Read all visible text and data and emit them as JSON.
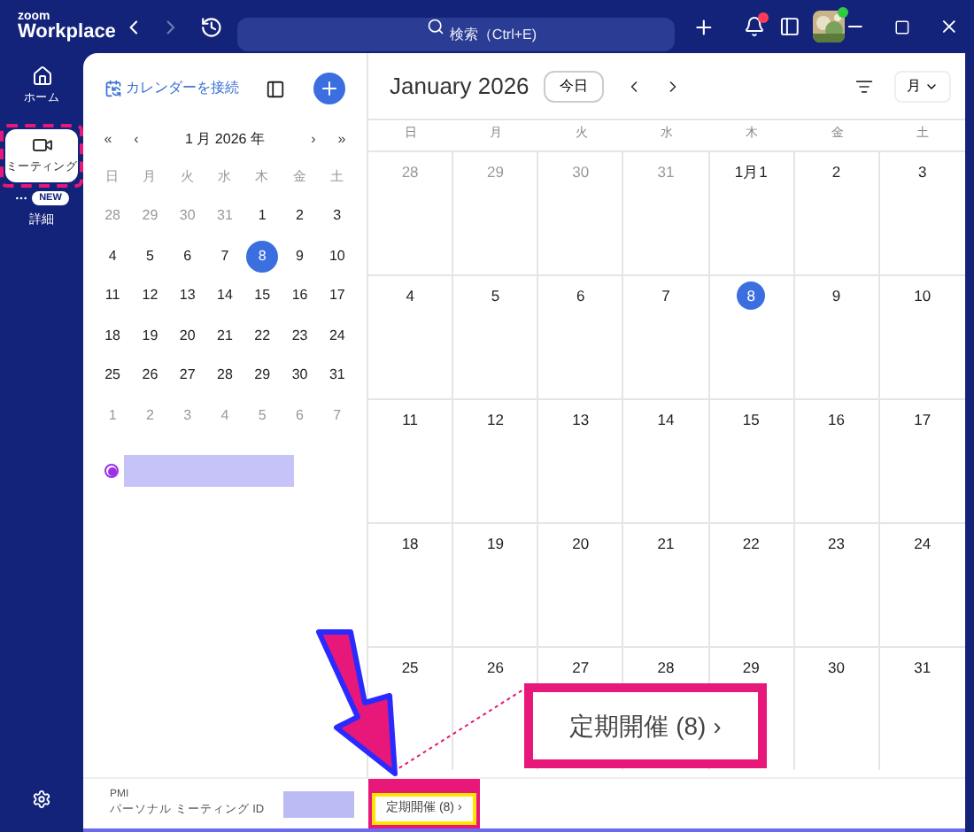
{
  "topbar": {
    "logo_small": "zoom",
    "logo": "Workplace",
    "search": {
      "placeholder": "検索（Ctrl+E)"
    },
    "notification": true
  },
  "rail": {
    "items": [
      {
        "label": "ホーム",
        "selected": false
      },
      {
        "label": "ミーティング",
        "selected": true
      }
    ],
    "more": {
      "badge": "NEW",
      "label": "詳細"
    }
  },
  "mini_calendar": {
    "connect": "カレンダーを接続",
    "nav": [
      "«",
      "‹",
      "›",
      "»"
    ],
    "month": "1 月 2026 年",
    "weekdays": [
      "日",
      "月",
      "火",
      "水",
      "木",
      "金",
      "土"
    ],
    "weeks": [
      [
        {
          "d": "28",
          "muted": true,
          "selected": false
        },
        {
          "d": "29",
          "muted": true,
          "selected": false
        },
        {
          "d": "30",
          "muted": true,
          "selected": false
        },
        {
          "d": "31",
          "muted": true,
          "selected": false
        },
        {
          "d": "1",
          "muted": false,
          "selected": false
        },
        {
          "d": "2",
          "muted": false,
          "selected": false
        },
        {
          "d": "3",
          "muted": false,
          "selected": false
        }
      ],
      [
        {
          "d": "4",
          "muted": false,
          "selected": false
        },
        {
          "d": "5",
          "muted": false,
          "selected": false
        },
        {
          "d": "6",
          "muted": false,
          "selected": false
        },
        {
          "d": "7",
          "muted": false,
          "selected": false
        },
        {
          "d": "8",
          "muted": false,
          "selected": true
        },
        {
          "d": "9",
          "muted": false,
          "selected": false
        },
        {
          "d": "10",
          "muted": false,
          "selected": false
        }
      ],
      [
        {
          "d": "11",
          "muted": false,
          "selected": false
        },
        {
          "d": "12",
          "muted": false,
          "selected": false
        },
        {
          "d": "13",
          "muted": false,
          "selected": false
        },
        {
          "d": "14",
          "muted": false,
          "selected": false
        },
        {
          "d": "15",
          "muted": false,
          "selected": false
        },
        {
          "d": "16",
          "muted": false,
          "selected": false
        },
        {
          "d": "17",
          "muted": false,
          "selected": false
        }
      ],
      [
        {
          "d": "18",
          "muted": false,
          "selected": false
        },
        {
          "d": "19",
          "muted": false,
          "selected": false
        },
        {
          "d": "20",
          "muted": false,
          "selected": false
        },
        {
          "d": "21",
          "muted": false,
          "selected": false
        },
        {
          "d": "22",
          "muted": false,
          "selected": false
        },
        {
          "d": "23",
          "muted": false,
          "selected": false
        },
        {
          "d": "24",
          "muted": false,
          "selected": false
        }
      ],
      [
        {
          "d": "25",
          "muted": false,
          "selected": false
        },
        {
          "d": "26",
          "muted": false,
          "selected": false
        },
        {
          "d": "27",
          "muted": false,
          "selected": false
        },
        {
          "d": "28",
          "muted": false,
          "selected": false
        },
        {
          "d": "29",
          "muted": false,
          "selected": false
        },
        {
          "d": "30",
          "muted": false,
          "selected": false
        },
        {
          "d": "31",
          "muted": false,
          "selected": false
        }
      ],
      [
        {
          "d": "1",
          "muted": true,
          "selected": false
        },
        {
          "d": "2",
          "muted": true,
          "selected": false
        },
        {
          "d": "3",
          "muted": true,
          "selected": false
        },
        {
          "d": "4",
          "muted": true,
          "selected": false
        },
        {
          "d": "5",
          "muted": true,
          "selected": false
        },
        {
          "d": "6",
          "muted": true,
          "selected": false
        },
        {
          "d": "7",
          "muted": true,
          "selected": false
        }
      ]
    ],
    "calendars": [
      {
        "color": "#9b30e8"
      }
    ]
  },
  "pmi": {
    "title": "PMI",
    "subtitle": "パーソナル ミーティング ID"
  },
  "calendar": {
    "title": "January 2026",
    "today": "今日",
    "view": "月",
    "weekdays": [
      "日",
      "月",
      "火",
      "水",
      "木",
      "金",
      "土"
    ],
    "weeks": [
      [
        {
          "d": "28",
          "muted": true,
          "selected": false
        },
        {
          "d": "29",
          "muted": true,
          "selected": false
        },
        {
          "d": "30",
          "muted": true,
          "selected": false
        },
        {
          "d": "31",
          "muted": true,
          "selected": false
        },
        {
          "d": "1月1",
          "muted": false,
          "selected": false
        },
        {
          "d": "2",
          "muted": false,
          "selected": false
        },
        {
          "d": "3",
          "muted": false,
          "selected": false
        }
      ],
      [
        {
          "d": "4",
          "muted": false,
          "selected": false
        },
        {
          "d": "5",
          "muted": false,
          "selected": false
        },
        {
          "d": "6",
          "muted": false,
          "selected": false
        },
        {
          "d": "7",
          "muted": false,
          "selected": false
        },
        {
          "d": "8",
          "muted": false,
          "selected": true
        },
        {
          "d": "9",
          "muted": false,
          "selected": false
        },
        {
          "d": "10",
          "muted": false,
          "selected": false
        }
      ],
      [
        {
          "d": "11",
          "muted": false,
          "selected": false
        },
        {
          "d": "12",
          "muted": false,
          "selected": false
        },
        {
          "d": "13",
          "muted": false,
          "selected": false
        },
        {
          "d": "14",
          "muted": false,
          "selected": false
        },
        {
          "d": "15",
          "muted": false,
          "selected": false
        },
        {
          "d": "16",
          "muted": false,
          "selected": false
        },
        {
          "d": "17",
          "muted": false,
          "selected": false
        }
      ],
      [
        {
          "d": "18",
          "muted": false,
          "selected": false
        },
        {
          "d": "19",
          "muted": false,
          "selected": false
        },
        {
          "d": "20",
          "muted": false,
          "selected": false
        },
        {
          "d": "21",
          "muted": false,
          "selected": false
        },
        {
          "d": "22",
          "muted": false,
          "selected": false
        },
        {
          "d": "23",
          "muted": false,
          "selected": false
        },
        {
          "d": "24",
          "muted": false,
          "selected": false
        }
      ],
      [
        {
          "d": "25",
          "muted": false,
          "selected": false
        },
        {
          "d": "26",
          "muted": false,
          "selected": false
        },
        {
          "d": "27",
          "muted": false,
          "selected": false
        },
        {
          "d": "28",
          "muted": false,
          "selected": false
        },
        {
          "d": "29",
          "muted": false,
          "selected": false
        },
        {
          "d": "30",
          "muted": false,
          "selected": false
        },
        {
          "d": "31",
          "muted": false,
          "selected": false
        }
      ]
    ]
  },
  "recurring_button": {
    "label": "定期開催 (8)",
    "chevron": "›"
  },
  "callout": {
    "label": "定期開催 (8)",
    "chevron": "›"
  }
}
